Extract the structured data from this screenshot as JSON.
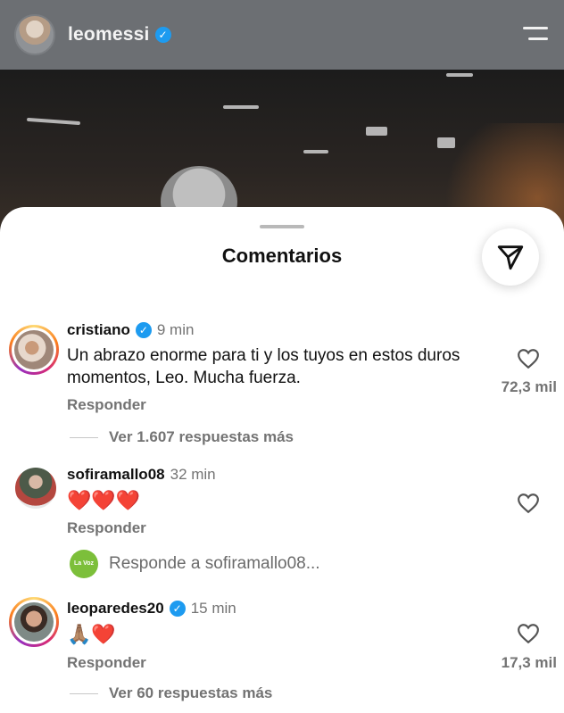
{
  "header": {
    "username": "leomessi",
    "menu_icon": "menu-icon"
  },
  "sheet": {
    "title": "Comentarios",
    "share_icon": "send-icon"
  },
  "comments": [
    {
      "username": "cristiano",
      "verified": true,
      "time": "9 min",
      "text": "Un abrazo enorme para ti y los tuyos en estos duros momentos, Leo. Mucha fuerza.",
      "reply_label": "Responder",
      "likes": "72,3 mil",
      "view_more": "Ver 1.607 respuestas más"
    },
    {
      "username": "sofiramallo08",
      "verified": false,
      "time": "32 min",
      "text": "❤️❤️❤️",
      "reply_label": "Responder",
      "likes": "",
      "reply_prompt": "Responde a sofiramallo08...",
      "reply_avatar_text": "La Voz"
    },
    {
      "username": "leoparedes20",
      "verified": true,
      "time": "15 min",
      "text": "🙏🏽❤️",
      "reply_label": "Responder",
      "likes": "17,3 mil",
      "view_more": "Ver 60 respuestas más"
    }
  ],
  "colors": {
    "verified_blue": "#1d9bf0",
    "muted_text": "#737373",
    "header_bg": "#6c6f73"
  }
}
